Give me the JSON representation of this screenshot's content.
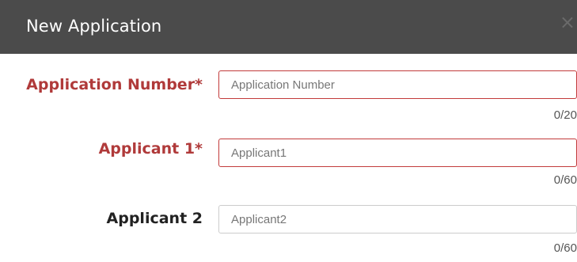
{
  "dialog": {
    "title": "New Application",
    "close_glyph": "×",
    "close_icon": "close-icon"
  },
  "fields": [
    {
      "label": "Application Number*",
      "placeholder": "Application Number",
      "value": "",
      "counter": "0/20",
      "required": true,
      "invalid": true
    },
    {
      "label": "Applicant 1*",
      "placeholder": "Applicant1",
      "value": "",
      "counter": "0/60",
      "required": true,
      "invalid": true
    },
    {
      "label": "Applicant 2",
      "placeholder": "Applicant2",
      "value": "",
      "counter": "0/60",
      "required": false,
      "invalid": false
    }
  ],
  "colors": {
    "header_bg": "#4b4b4b",
    "required_label": "#b03a3a",
    "error_border": "#c23b3b",
    "normal_border": "#cccccc"
  }
}
